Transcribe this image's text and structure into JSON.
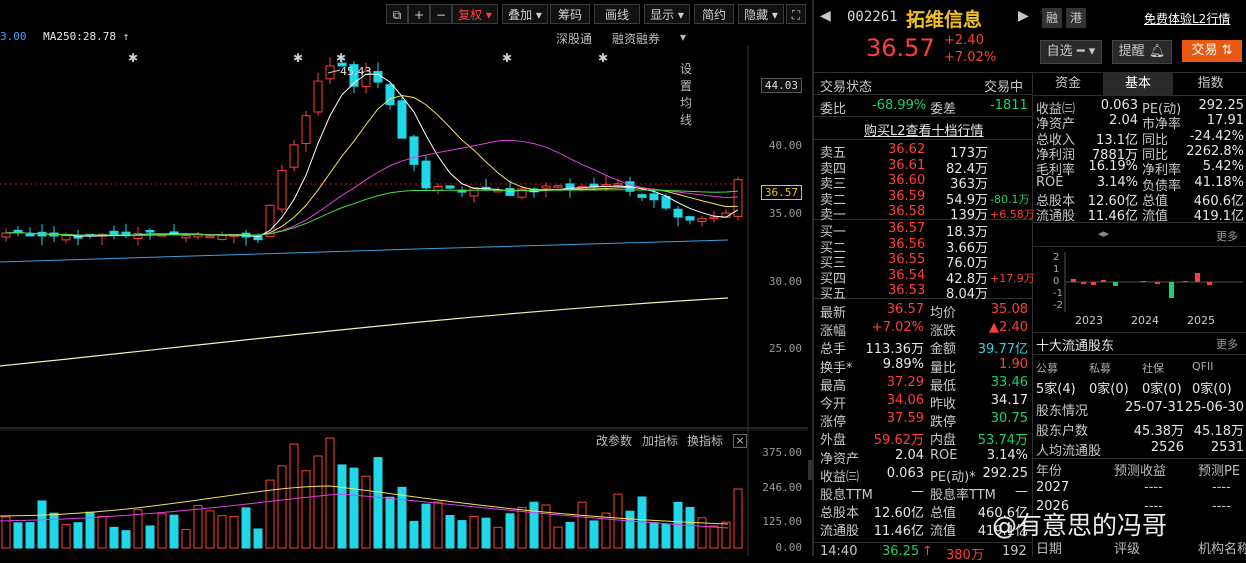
{
  "toolbar": {
    "icons": [
      "copy-icon",
      "plus-icon",
      "minus-icon"
    ],
    "fuquan": "复权",
    "diejia": "叠加",
    "chouma": "筹码",
    "huaxian": "画线",
    "xianshi": "显示",
    "jianyue": "简约",
    "yincang": "隐藏"
  },
  "ma_legend": {
    "ma_prev": "3.00",
    "ma250_label": "MA250:28.78",
    "arrow": "↑"
  },
  "ma_links": {
    "shengutong": "深股通",
    "rongzi": "融资融券",
    "setup": "设置均线"
  },
  "peak_label": "45.43",
  "price_axis": [
    "44.03",
    "40.00",
    "35.00",
    "30.00",
    "25.00"
  ],
  "current_price_tag": "36.57",
  "vol_tools": {
    "change": "改参数",
    "add": "加指标",
    "swap": "换指标"
  },
  "vol_axis": [
    "375.00",
    "246.00",
    "125.00",
    "0.00"
  ],
  "colors": {
    "up": "#ff3d3d",
    "down": "#19d36a",
    "accent": "#f0c020",
    "cyan": "#2fd7e0"
  },
  "stock": {
    "code": "002261",
    "name": "拓维信息",
    "rong": "融",
    "gang": "港",
    "l2": "免费体验L2行情",
    "price": "36.57",
    "change": "+2.40",
    "pct": "+7.02%",
    "zixuan": "自选",
    "tixing": "提醒",
    "jiaoyi": "交易"
  },
  "status": {
    "label": "交易状态",
    "value": "交易中"
  },
  "weibi": {
    "label": "委比",
    "value": "-68.99%",
    "label2": "委差",
    "value2": "-1811"
  },
  "buy_l2": "购买L2查看十档行情",
  "asks": [
    {
      "label": "卖五",
      "price": "36.62",
      "vol": "173万",
      "extra": ""
    },
    {
      "label": "卖四",
      "price": "36.61",
      "vol": "82.4万",
      "extra": ""
    },
    {
      "label": "卖三",
      "price": "36.60",
      "vol": "363万",
      "extra": ""
    },
    {
      "label": "卖二",
      "price": "36.59",
      "vol": "54.9万",
      "extra": "-80.1万"
    },
    {
      "label": "卖一",
      "price": "36.58",
      "vol": "139万",
      "extra": "+6.58万"
    }
  ],
  "bids": [
    {
      "label": "买一",
      "price": "36.57",
      "vol": "18.3万",
      "extra": ""
    },
    {
      "label": "买二",
      "price": "36.56",
      "vol": "3.66万",
      "extra": ""
    },
    {
      "label": "买三",
      "price": "36.55",
      "vol": "76.0万",
      "extra": ""
    },
    {
      "label": "买四",
      "price": "36.54",
      "vol": "42.8万",
      "extra": "+17.9万"
    },
    {
      "label": "买五",
      "price": "36.53",
      "vol": "8.04万",
      "extra": ""
    }
  ],
  "quote": [
    {
      "l1": "最新",
      "v1": "36.57",
      "l2": "均价",
      "v2": "35.08"
    },
    {
      "l1": "涨幅",
      "v1": "+7.02%",
      "l2": "涨跌",
      "v2": "▲2.40"
    },
    {
      "l1": "总手",
      "v1": "113.36万",
      "l2": "金额",
      "v2": "39.77亿"
    },
    {
      "l1": "换手*",
      "v1": "9.89%",
      "l2": "量比",
      "v2": "1.90"
    },
    {
      "l1": "最高",
      "v1": "37.29",
      "l2": "最低",
      "v2": "33.46"
    },
    {
      "l1": "今开",
      "v1": "34.06",
      "l2": "昨收",
      "v2": "34.17"
    },
    {
      "l1": "涨停",
      "v1": "37.59",
      "l2": "跌停",
      "v2": "30.75"
    },
    {
      "l1": "外盘",
      "v1": "59.62万",
      "l2": "内盘",
      "v2": "53.74万"
    },
    {
      "l1": "净资产",
      "v1": "2.04",
      "l2": "ROE",
      "v2": "3.14%"
    },
    {
      "l1": "收益㈢",
      "v1": "0.063",
      "l2": "PE(动)*",
      "v2": "292.25"
    },
    {
      "l1": "股息TTM",
      "v1": "—",
      "l2": "股息率TTM",
      "v2": "—"
    },
    {
      "l1": "总股本",
      "v1": "12.60亿",
      "l2": "总值",
      "v2": "460.6亿"
    },
    {
      "l1": "流通股",
      "v1": "11.46亿",
      "l2": "流值",
      "v2": "419.1亿"
    }
  ],
  "tick": {
    "time": "14:40",
    "price": "36.25",
    "arrow": "↑",
    "vol": "380万",
    "num": "192"
  },
  "tabs": [
    "资金",
    "基本",
    "指数"
  ],
  "fund": [
    {
      "l1": "收益㈢",
      "v1": "0.063",
      "l2": "PE(动)",
      "v2": "292.25"
    },
    {
      "l1": "净资产",
      "v1": "2.04",
      "l2": "市净率",
      "v2": "17.91"
    },
    {
      "l1": "总收入",
      "v1": "13.1亿",
      "l2": "同比",
      "v2": "-24.42%"
    },
    {
      "l1": "净利润",
      "v1": "7881万",
      "l2": "同比",
      "v2": "2262.8%"
    },
    {
      "l1": "毛利率",
      "v1": "16.19%",
      "l2": "净利率",
      "v2": "5.42%"
    },
    {
      "l1": "ROE",
      "v1": "3.14%",
      "l2": "负债率",
      "v2": "41.18%"
    },
    {
      "l1": "总股本",
      "v1": "12.60亿",
      "l2": "总值",
      "v2": "460.6亿"
    },
    {
      "l1": "流通股",
      "v1": "11.46亿",
      "l2": "流值",
      "v2": "419.1亿"
    }
  ],
  "more": "更多",
  "mini_chart": {
    "yticks": [
      "2",
      "1",
      "0",
      "-1",
      "-2"
    ],
    "years": [
      "2023",
      "2024",
      "2025"
    ]
  },
  "holders": {
    "title": "十大流通股东",
    "headers": [
      "公募",
      "私募",
      "社保",
      "QFII"
    ],
    "values": [
      "5家(4)",
      "0家(0)",
      "0家(0)",
      "0家(0)"
    ],
    "rows": [
      {
        "label": "股东情况",
        "a": "25-07-31",
        "b": "25-06-30"
      },
      {
        "label": "股东户数",
        "a": "45.38万",
        "b": "45.18万"
      },
      {
        "label": "人均流通股",
        "a": "2526",
        "b": "2531"
      }
    ]
  },
  "forecast": {
    "headers": [
      "年份",
      "预测收益",
      "预测PE"
    ],
    "rows": [
      {
        "year": "2027",
        "eps": "----",
        "pe": "----"
      },
      {
        "year": "2026",
        "eps": "----",
        "pe": "----"
      }
    ],
    "footer": [
      "日期",
      "评级",
      "机构名称"
    ]
  },
  "watermark": "@有意思的冯哥"
}
